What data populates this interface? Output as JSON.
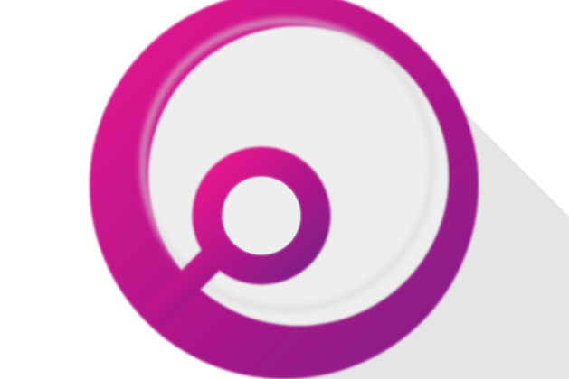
{
  "icon": {
    "name": "search-icon",
    "gradient_start": "#ec168f",
    "gradient_end": "#7d1b86",
    "inner_fill": "#eeeeee",
    "long_shadow": "#e2e2e2"
  }
}
